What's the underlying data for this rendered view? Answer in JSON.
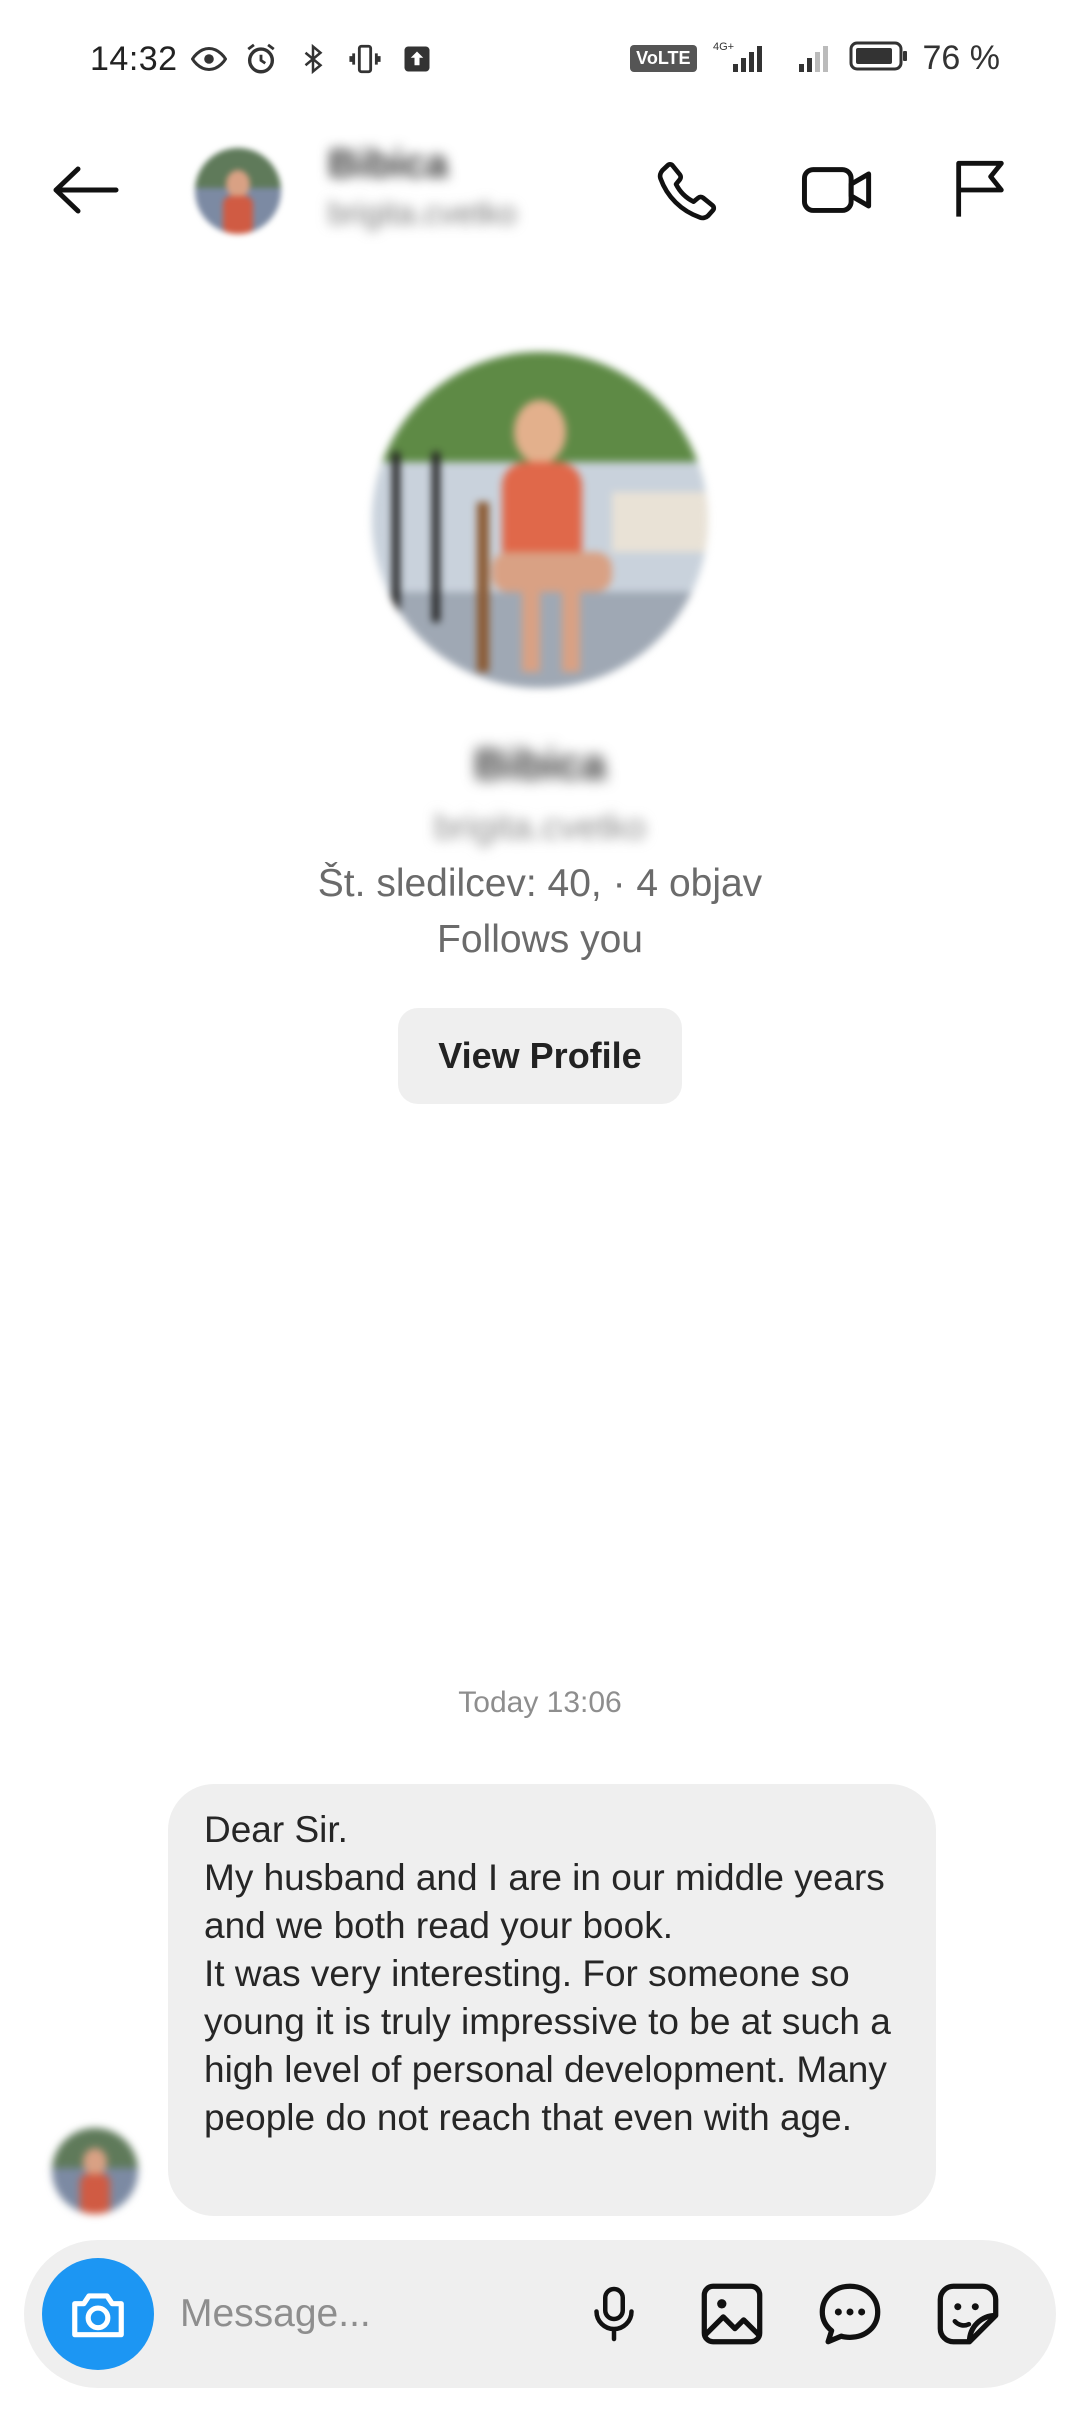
{
  "status_bar": {
    "time": "14:32",
    "battery_text": "76 %",
    "network_label": "VoLTE",
    "icons": [
      "eye-icon",
      "alarm-icon",
      "bluetooth-icon",
      "vibrate-icon",
      "upload-icon",
      "signal-icon",
      "battery-icon"
    ]
  },
  "header": {
    "name": "Bibica",
    "username": "brigita.cvetko",
    "icons": [
      "back-arrow-icon",
      "phone-icon",
      "video-camera-icon",
      "flag-icon"
    ]
  },
  "profile": {
    "name": "Bibica",
    "username": "brigita.cvetko",
    "stats": "Št. sledilcev: 40, · 4 objav",
    "follows_you": "Follows you",
    "view_profile_label": "View Profile"
  },
  "chat": {
    "timestamp": "Today 13:06",
    "messages": [
      {
        "sender": "other",
        "text": "Dear Sir.\nMy husband and I are in our middle years and we both read your book.\nIt was very interesting. For someone so young it is truly impressive to be at such a high level of personal development. Many people do not reach that even with age."
      }
    ]
  },
  "composer": {
    "placeholder": "Message...",
    "icons": [
      "camera-icon",
      "microphone-icon",
      "gallery-icon",
      "chat-bubble-icon",
      "sticker-icon"
    ]
  },
  "colors": {
    "accent": "#1c96f3",
    "bubble_bg": "#efefef",
    "muted_text": "#6b6b6b"
  }
}
